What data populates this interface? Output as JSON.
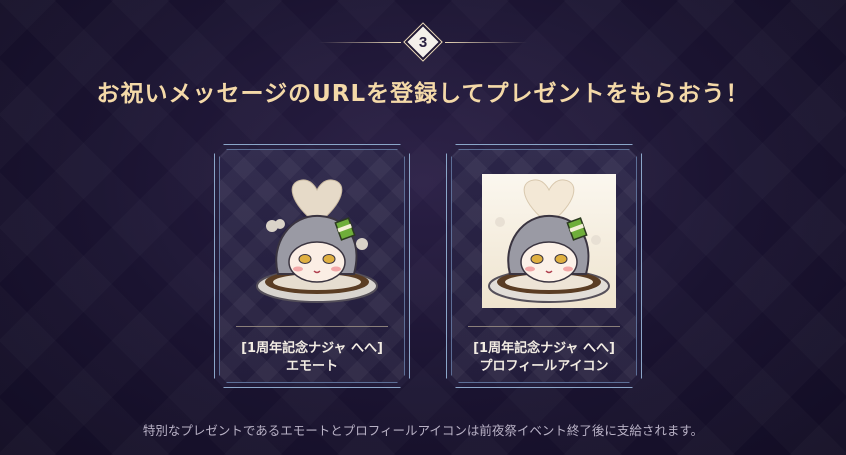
{
  "step": {
    "number": "3"
  },
  "headline": "お祝いメッセージのURLを登録してプレゼントをもらおう！",
  "cards": [
    {
      "title": "[1周年記念ナジャ へへ]",
      "subtitle": "エモート",
      "image": "chibi-character-in-curry-emote"
    },
    {
      "title": "[1周年記念ナジャ へへ]",
      "subtitle": "プロフィールアイコン",
      "image": "chibi-character-in-curry-profile-icon"
    }
  ],
  "footnote": "特別なプレゼントであるエモートとプロフィールアイコンは前夜祭イベント終了後に支給されます。",
  "colors": {
    "accent_gold": "#f4d9a8",
    "card_border": "#8ba6c9",
    "background": "#1a1330"
  }
}
